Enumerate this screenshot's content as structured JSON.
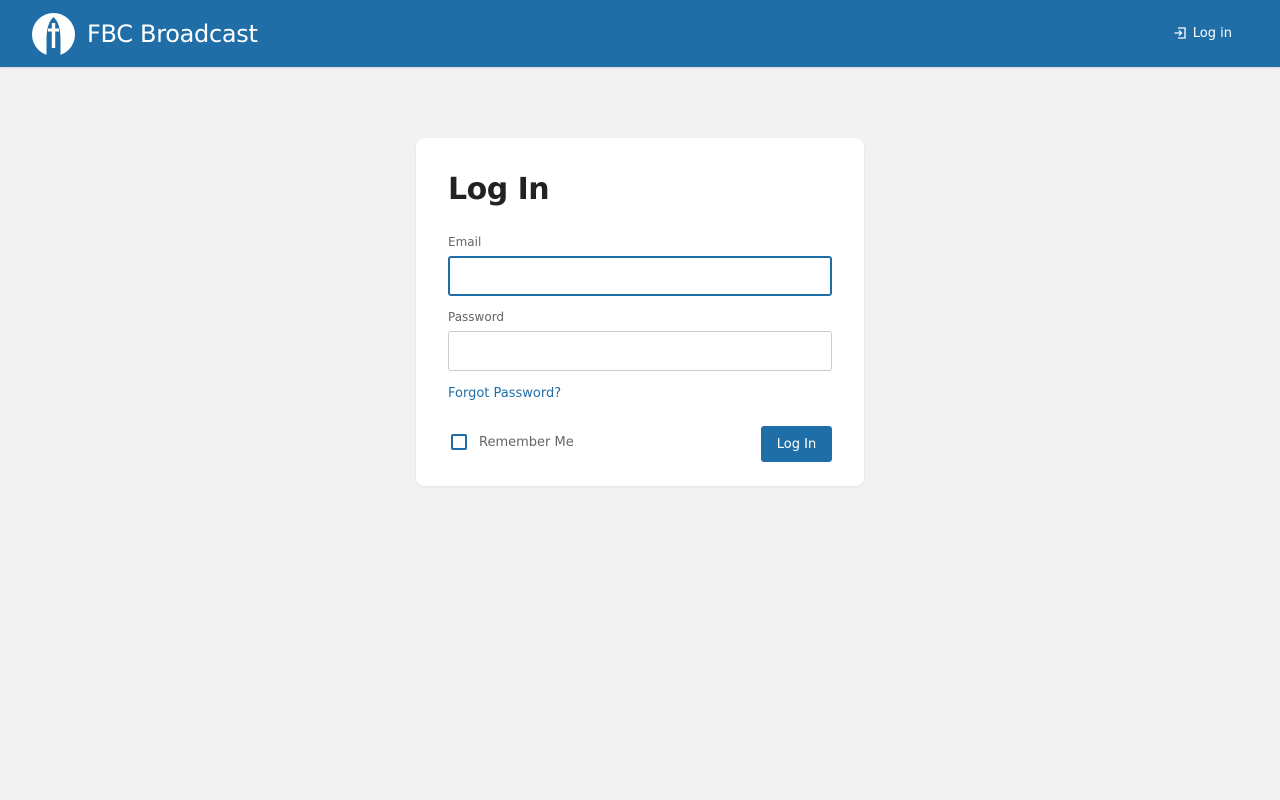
{
  "header": {
    "brand_name": "FBC Broadcast",
    "logo_icon": "church-cross-logo-icon",
    "login_icon": "sign-in-icon",
    "login_label": "Log in",
    "background_color": "#1f6ea8"
  },
  "login_card": {
    "title": "Log In",
    "email_label": "Email",
    "email_value": "",
    "password_label": "Password",
    "password_value": "",
    "forgot_password_label": "Forgot Password?",
    "remember_me_label": "Remember Me",
    "remember_me_checked": false,
    "submit_label": "Log In"
  },
  "colors": {
    "accent": "#1f6ea8",
    "page_background": "#f2f2f2",
    "card_background": "#ffffff"
  }
}
